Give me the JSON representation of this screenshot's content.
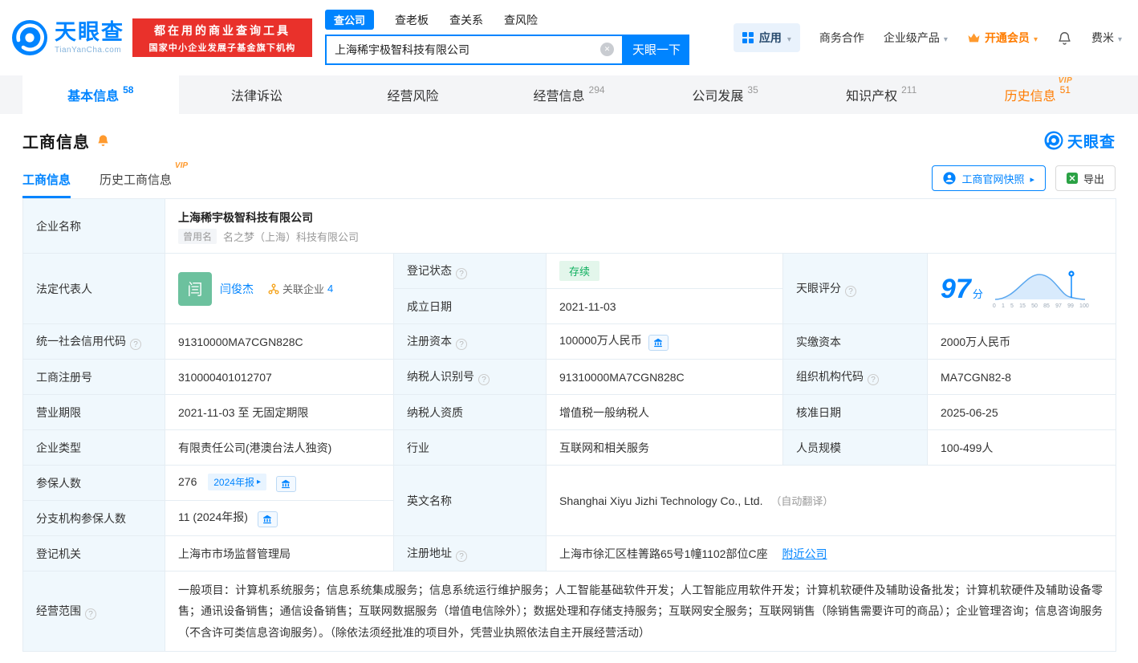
{
  "header": {
    "brand": {
      "name": "天眼查",
      "domain": "TianYanCha.com"
    },
    "slogan_line1": "都在用的商业查询工具",
    "slogan_line2": "国家中小企业发展子基金旗下机构",
    "search_tabs": [
      {
        "label": "查公司"
      },
      {
        "label": "查老板"
      },
      {
        "label": "查关系"
      },
      {
        "label": "查风险"
      }
    ],
    "search": {
      "value": "上海稀宇极智科技有限公司",
      "button": "天眼一下"
    },
    "nav": {
      "app": "应用",
      "cooperation": "商务合作",
      "enterprise": "企业级产品",
      "vip": "开通会员",
      "user": "费米"
    }
  },
  "nav_tabs": [
    {
      "label": "基本信息",
      "count": "58"
    },
    {
      "label": "法律诉讼",
      "count": ""
    },
    {
      "label": "经营风险",
      "count": ""
    },
    {
      "label": "经营信息",
      "count": "294"
    },
    {
      "label": "公司发展",
      "count": "35"
    },
    {
      "label": "知识产权",
      "count": "211"
    },
    {
      "label": "历史信息",
      "count": "51",
      "vip": "VIP"
    }
  ],
  "section": {
    "title": "工商信息",
    "brand_mark": "天眼查",
    "subtabs": [
      {
        "label": "工商信息"
      },
      {
        "label": "历史工商信息",
        "vip": "VIP"
      }
    ],
    "snapshot_button": "工商官网快照",
    "export_button": "导出"
  },
  "company": {
    "name_label": "企业名称",
    "name": "上海稀宇极智科技有限公司",
    "former_badge": "曾用名",
    "former_name": "名之梦（上海）科技有限公司",
    "legal_rep_label": "法定代表人",
    "legal_rep_avatar": "闫",
    "legal_rep_name": "闫俊杰",
    "related_label": "关联企业",
    "related_count": "4",
    "reg_status_label": "登记状态",
    "reg_status": "存续",
    "score_label": "天眼评分",
    "score": "97",
    "score_unit": "分",
    "score_ticks": [
      "0",
      "1",
      "5",
      "15",
      "50",
      "85",
      "97",
      "99",
      "100"
    ],
    "establish_label": "成立日期",
    "establish_date": "2021-11-03",
    "credit_code_label": "统一社会信用代码",
    "credit_code": "91310000MA7CGN828C",
    "reg_capital_label": "注册资本",
    "reg_capital": "100000万人民币",
    "paid_capital_label": "实缴资本",
    "paid_capital": "2000万人民币",
    "reg_no_label": "工商注册号",
    "reg_no": "310000401012707",
    "taxpayer_id_label": "纳税人识别号",
    "taxpayer_id": "91310000MA7CGN828C",
    "org_code_label": "组织机构代码",
    "org_code": "MA7CGN82-8",
    "term_label": "营业期限",
    "term": "2021-11-03 至 无固定期限",
    "taxpayer_quality_label": "纳税人资质",
    "taxpayer_quality": "增值税一般纳税人",
    "approval_label": "核准日期",
    "approval_date": "2025-06-25",
    "type_label": "企业类型",
    "type": "有限责任公司(港澳台法人独资)",
    "industry_label": "行业",
    "industry": "互联网和相关服务",
    "staff_label": "人员规模",
    "staff": "100-499人",
    "insured_label": "参保人数",
    "insured": "276",
    "insured_badge": "2024年报",
    "english_label": "英文名称",
    "english_name": "Shanghai Xiyu Jizhi Technology Co., Ltd.",
    "english_note": "（自动翻译）",
    "branch_label": "分支机构参保人数",
    "branch_insured": "11 (2024年报)",
    "authority_label": "登记机关",
    "authority": "上海市市场监督管理局",
    "address_label": "注册地址",
    "address": "上海市徐汇区桂箐路65号1幢1102部位C座",
    "nearby": "附近公司",
    "scope_label": "经营范围",
    "scope": "一般项目：计算机系统服务；信息系统集成服务；信息系统运行维护服务；人工智能基础软件开发；人工智能应用软件开发；计算机软硬件及辅助设备批发；计算机软硬件及辅助设备零售；通讯设备销售；通信设备销售；互联网数据服务（增值电信除外）；数据处理和存储支持服务；互联网安全服务；互联网销售（除销售需要许可的商品）；企业管理咨询；信息咨询服务（不含许可类信息咨询服务）。（除依法须经批准的项目外，凭营业执照依法自主开展经营活动）"
  },
  "colors": {
    "brand_blue": "#0084ff",
    "vip_orange": "#ff9a2e",
    "status_green": "#0eaf5e",
    "slogan_red": "#e9312b",
    "label_bg": "#f0f8fd"
  }
}
